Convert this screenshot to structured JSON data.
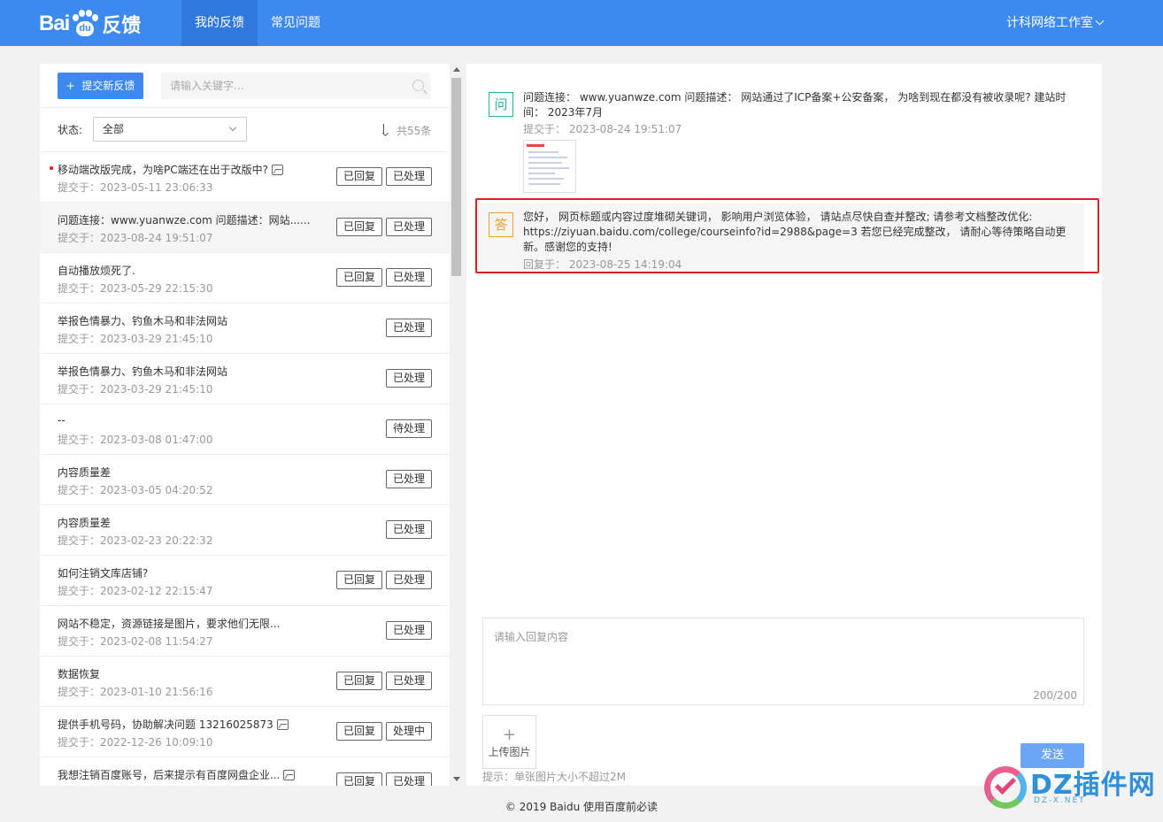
{
  "header": {
    "logo_text": "Bai",
    "logo_paw_text": "du",
    "logo_suffix": "反馈",
    "tabs": [
      {
        "label": "我的反馈",
        "active": true
      },
      {
        "label": "常见问题",
        "active": false
      }
    ],
    "user_name": "计科网络工作室"
  },
  "sidebar": {
    "submit_button": "提交新反馈",
    "submit_icon": "+",
    "search_placeholder": "请输入关键字...",
    "status_label": "状态:",
    "status_value": "全部",
    "total_count": "共55条",
    "items": [
      {
        "title": "移动端改版完成，为啥PC端还在出于改版中?",
        "has_image": true,
        "unread": true,
        "meta": "提交于：2023-05-11 23:06:33",
        "tags": [
          "已回复",
          "已处理"
        ]
      },
      {
        "title": "问题连接：www.yuanwze.com 问题描述：网站......",
        "has_image": false,
        "unread": false,
        "meta": "提交于：2023-08-24 19:51:07",
        "tags": [
          "已回复",
          "已处理"
        ]
      },
      {
        "title": "自动播放烦死了.",
        "has_image": false,
        "unread": false,
        "meta": "提交于：2023-05-29 22:15:30",
        "tags": [
          "已回复",
          "已处理"
        ]
      },
      {
        "title": "举报色情暴力、钓鱼木马和非法网站",
        "has_image": false,
        "unread": false,
        "meta": "提交于：2023-03-29 21:45:10",
        "tags": [
          "已处理"
        ]
      },
      {
        "title": "举报色情暴力、钓鱼木马和非法网站",
        "has_image": false,
        "unread": false,
        "meta": "提交于：2023-03-29 21:45:10",
        "tags": [
          "已处理"
        ]
      },
      {
        "title": "--",
        "has_image": false,
        "unread": false,
        "meta": "提交于：2023-03-08 01:47:00",
        "tags": [
          "待处理"
        ]
      },
      {
        "title": "内容质量差",
        "has_image": false,
        "unread": false,
        "meta": "提交于：2023-03-05 04:20:52",
        "tags": [
          "已处理"
        ]
      },
      {
        "title": "内容质量差",
        "has_image": false,
        "unread": false,
        "meta": "提交于：2023-02-23 20:22:32",
        "tags": [
          "已处理"
        ]
      },
      {
        "title": "如何注销文库店铺?",
        "has_image": false,
        "unread": false,
        "meta": "提交于：2023-02-12 22:15:47",
        "tags": [
          "已回复",
          "已处理"
        ]
      },
      {
        "title": "网站不稳定，资源链接是图片，要求他们无限...",
        "has_image": false,
        "unread": false,
        "meta": "提交于：2023-02-08 11:54:27",
        "tags": [
          "已处理"
        ]
      },
      {
        "title": "数据恢复",
        "has_image": false,
        "unread": false,
        "meta": "提交于：2023-01-10 21:56:16",
        "tags": [
          "已回复",
          "已处理"
        ]
      },
      {
        "title": "提供手机号码，协助解决问题 13216025873",
        "has_image": true,
        "unread": false,
        "meta": "提交于：2022-12-26 10:09:10",
        "tags": [
          "已回复",
          "处理中"
        ]
      },
      {
        "title": "我想注销百度账号，后来提示有百度网盘企业...",
        "has_image": true,
        "unread": false,
        "meta": "",
        "tags": [
          "已回复",
          "已处理"
        ]
      }
    ]
  },
  "conversation": {
    "question": {
      "badge": "问",
      "text": "问题连接： www.yuanwze.com 问题描述： 网站通过了ICP备案+公安备案， 为啥到现在都没有被收录呢? 建站时间： 2023年7月",
      "time": "提交于： 2023-08-24 19:51:07"
    },
    "answer": {
      "badge": "答",
      "text": "您好， 网页标题或内容过度堆砌关键词， 影响用户浏览体验， 请站点尽快自查并整改; 请参考文档整改优化: https://ziyuan.baidu.com/college/courseinfo?id=2988&page=3 若您已经完成整改， 请耐心等待策略自动更新。感谢您的支持!",
      "time": "回复于： 2023-08-25 14:19:04"
    },
    "reply_placeholder": "请输入回复内容",
    "char_count": "200/200",
    "upload_icon": "+",
    "upload_label": "上传图片",
    "hint": "提示：单张图片大小不超过2M",
    "send_label": "发送"
  },
  "footer": {
    "text": "© 2019 Baidu 使用百度前必读"
  },
  "watermark": {
    "text": "DZ插件网",
    "subtext": "DZ-X.NET"
  },
  "colors": {
    "brand": "#3c8af0",
    "highlight": "#e02020",
    "question_badge": "#2bb0a0",
    "answer_badge": "#f0a030"
  }
}
